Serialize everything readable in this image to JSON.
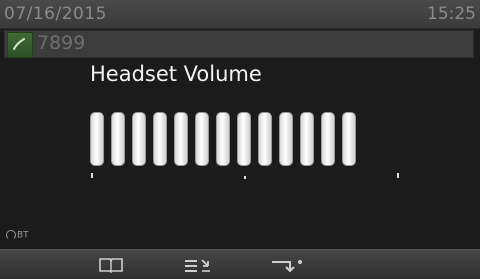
{
  "status_bar": {
    "date": "07/16/2015",
    "time": "15:25"
  },
  "line": {
    "number": "7899",
    "icon": "handset-icon"
  },
  "volume": {
    "title": "Headset Volume",
    "level_bars": 13
  },
  "bluetooth": {
    "label": "BT",
    "icon": "headset-icon"
  },
  "softkeys": [
    {
      "icon": "directory-book-icon"
    },
    {
      "icon": "call-list-icon"
    },
    {
      "icon": "forward-icon"
    }
  ]
}
